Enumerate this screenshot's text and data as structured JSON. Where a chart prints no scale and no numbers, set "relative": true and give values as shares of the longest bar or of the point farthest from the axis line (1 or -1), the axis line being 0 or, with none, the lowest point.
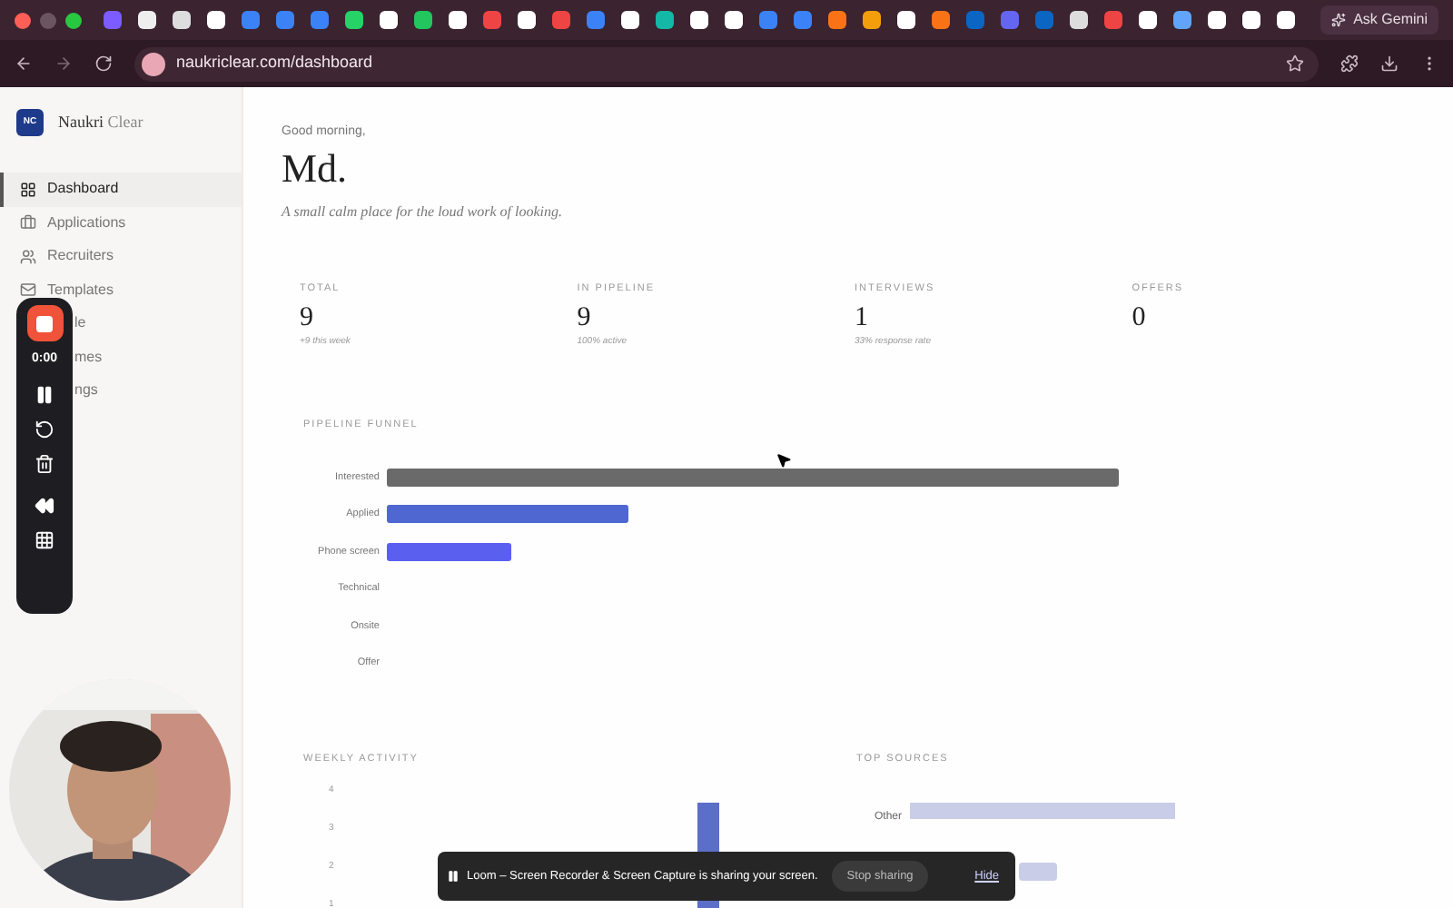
{
  "browser": {
    "ask_button": "Ask Gemini",
    "url": "naukriclear.com/dashboard"
  },
  "sidebar": {
    "logo": "NC",
    "brand_name": "Naukri",
    "brand_suffix": "Clear",
    "items": [
      {
        "label": "Dashboard",
        "kind": "nav",
        "selected": true
      },
      {
        "label": "Applications",
        "kind": "nav",
        "selected": false
      },
      {
        "label": "Recruiters",
        "kind": "nav",
        "selected": false
      },
      {
        "label": "Templates",
        "kind": "nav",
        "selected": false
      },
      {
        "label": "le",
        "kind": "partial",
        "selected": false
      },
      {
        "label": "mes",
        "kind": "partial",
        "selected": false
      },
      {
        "label": "ngs",
        "kind": "partial",
        "selected": false
      }
    ]
  },
  "greeting": "Good morning,",
  "name": "Md.",
  "tagline": "A small calm place for the loud work of looking.",
  "stats": [
    {
      "label": "TOTAL",
      "value": "9",
      "note": "+9 this week"
    },
    {
      "label": "IN PIPELINE",
      "value": "9",
      "note": "100% active"
    },
    {
      "label": "INTERVIEWS",
      "value": "1",
      "note": "33% response rate"
    },
    {
      "label": "OFFERS",
      "value": "0"
    }
  ],
  "funnel": {
    "title": "PIPELINE FUNNEL",
    "chart_data": {
      "type": "bar",
      "orientation": "horizontal",
      "categories": [
        "Interested",
        "Applied",
        "Phone screen",
        "Technical",
        "Onsite",
        "Offer"
      ],
      "relative": true,
      "series": [
        {
          "values": [
            1,
            0.33,
            0.17,
            0,
            0,
            0
          ]
        }
      ]
    }
  },
  "weekly_activity": {
    "title": "WEEKLY ACTIVITY",
    "y_ticks": [
      "4",
      "3",
      "2",
      "1"
    ]
  },
  "top_sources": {
    "title": "TOP SOURCES",
    "labels": [
      "Other"
    ]
  },
  "recorder": {
    "timer": "0:00"
  },
  "share_banner": {
    "message": "Loom – Screen Recorder & Screen Capture is sharing your screen.",
    "stop_button": "Stop sharing",
    "hide_link": "Hide"
  }
}
